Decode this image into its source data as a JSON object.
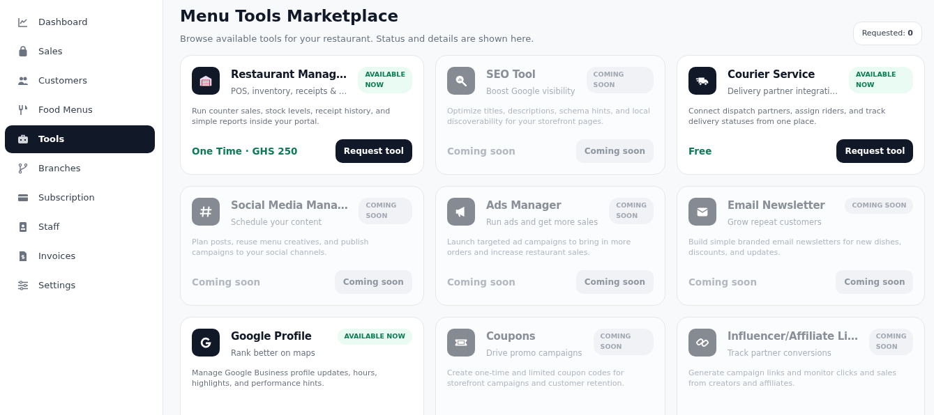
{
  "sidebar": {
    "items": [
      {
        "label": "Dashboard",
        "selected": false
      },
      {
        "label": "Sales",
        "selected": false
      },
      {
        "label": "Customers",
        "selected": false
      },
      {
        "label": "Food Menus",
        "selected": false
      },
      {
        "label": "Tools",
        "selected": true
      },
      {
        "label": "Branches",
        "selected": false
      },
      {
        "label": "Subscription",
        "selected": false
      },
      {
        "label": "Staff",
        "selected": false
      },
      {
        "label": "Invoices",
        "selected": false
      },
      {
        "label": "Settings",
        "selected": false
      }
    ]
  },
  "header": {
    "title": "Menu Tools Marketplace",
    "subtitle": "Browse available tools for your restaurant. Status and details are shown here.",
    "requested_label": "Requested:",
    "requested_count": "0"
  },
  "tools": [
    {
      "kind": "available",
      "title": "Restaurant Manag…",
      "subtitle": "POS, inventory, receipts & …",
      "badge": "AVAILABLE NOW",
      "description": "Run counter sales, stock levels, receipt history, and simple reports inside your portal.",
      "price": "One Time · GHS 250",
      "button": "Request tool"
    },
    {
      "kind": "coming_soon",
      "title": "SEO Tool",
      "subtitle": "Boost Google visibility",
      "badge": "COMING SOON",
      "description": "Optimize titles, descriptions, schema hints, and local discoverability for your storefront pages.",
      "price": "Coming soon",
      "button": "Coming soon"
    },
    {
      "kind": "available",
      "title": "Courier Service",
      "subtitle": "Delivery partner integrati…",
      "badge": "AVAILABLE NOW",
      "description": "Connect dispatch partners, assign riders, and track delivery statuses from one place.",
      "price": "Free",
      "button": "Request tool"
    },
    {
      "kind": "coming_soon",
      "title": "Social Media Mana…",
      "subtitle": "Schedule your content",
      "badge": "COMING SOON",
      "description": "Plan posts, reuse menu creatives, and publish campaigns to your social channels.",
      "price": "Coming soon",
      "button": "Coming soon"
    },
    {
      "kind": "coming_soon",
      "title": "Ads Manager",
      "subtitle": "Run ads and get more sales",
      "badge": "COMING SOON",
      "description": "Launch targeted ad campaigns to bring in more orders and increase restaurant sales.",
      "price": "Coming soon",
      "button": "Coming soon"
    },
    {
      "kind": "coming_soon",
      "title": "Email Newsletter",
      "subtitle": "Grow repeat customers",
      "badge": "COMING SOON",
      "description": "Build simple branded email newsletters for new dishes, discounts, and updates.",
      "price": "Coming soon",
      "button": "Coming soon"
    },
    {
      "kind": "available",
      "title": "Google Profile",
      "subtitle": "Rank better on maps",
      "badge": "AVAILABLE NOW",
      "description": "Manage Google Business profile updates, hours, highlights, and performance hints."
    },
    {
      "kind": "coming_soon",
      "title": "Coupons",
      "subtitle": "Drive promo campaigns",
      "badge": "COMING SOON",
      "description": "Create one-time and limited coupon codes for storefront campaigns and customer retention."
    },
    {
      "kind": "coming_soon",
      "title": "Influencer/Affiliate Li…",
      "subtitle": "Track partner conversions",
      "badge": "COMING SOON",
      "description": "Generate campaign links and monitor clicks and sales from creators and affiliates."
    }
  ]
}
